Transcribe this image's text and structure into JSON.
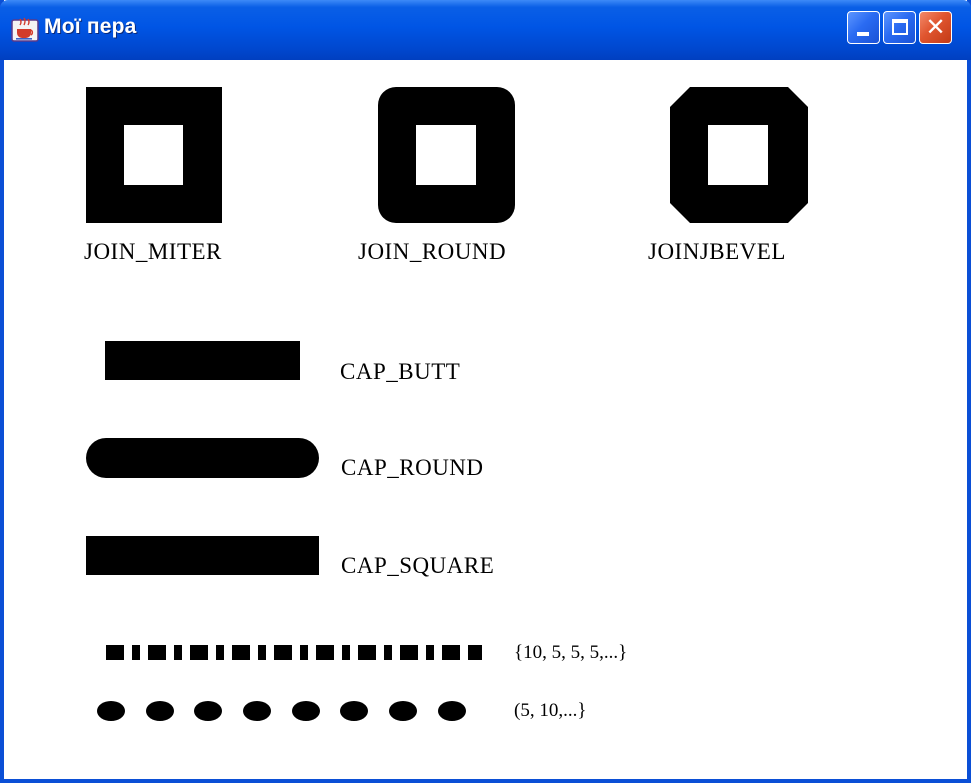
{
  "window": {
    "title": "Мої пера",
    "icon": "java-cup-icon",
    "buttons": {
      "minimize": "minimize-icon",
      "maximize": "maximize-icon",
      "close": "close-icon"
    }
  },
  "joins": {
    "miter": "JOIN_MITER",
    "round": "JOIN_ROUND",
    "bevel": "JOINJBEVEL"
  },
  "caps": {
    "butt": "CAP_BUTT",
    "round": "CAP_ROUND",
    "square": "CAP_SQUARE"
  },
  "dashes": {
    "pattern1": "{10, 5, 5, 5,...}",
    "pattern2": "(5, 10,...}"
  },
  "colors": {
    "titlebar": "#0055e5",
    "close_button": "#e0552f",
    "stroke": "#000000",
    "background": "#ffffff"
  }
}
